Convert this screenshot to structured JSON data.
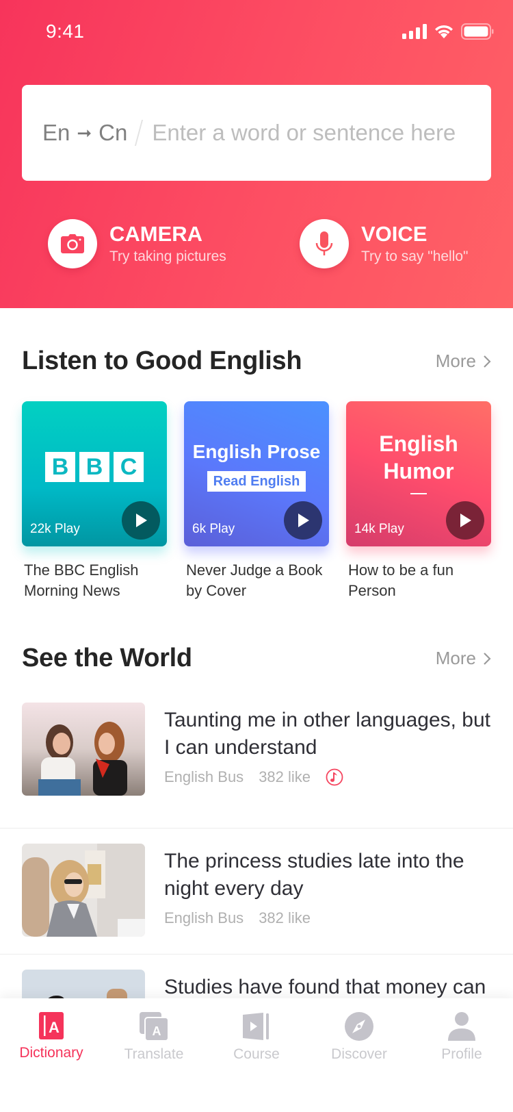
{
  "status_bar": {
    "time": "9:41",
    "icons": [
      "signal-icon",
      "wifi-icon",
      "battery-icon"
    ]
  },
  "search": {
    "source_lang": "En",
    "arrow": "➞",
    "target_lang": "Cn",
    "placeholder": "Enter a word or sentence here",
    "value": ""
  },
  "quick_actions": [
    {
      "icon": "camera-icon",
      "title": "CAMERA",
      "subtitle": "Try taking pictures"
    },
    {
      "icon": "microphone-icon",
      "title": "VOICE",
      "subtitle": "Try to say \"hello\""
    }
  ],
  "listen_section": {
    "title": "Listen to Good English",
    "more_label": "More",
    "cards": [
      {
        "cover": "BBC",
        "logo_letters": [
          "B",
          "B",
          "C"
        ],
        "plays": "22k Play",
        "caption": "The BBC English Morning News"
      },
      {
        "cover": "English Prose",
        "cover_tag": "Read English",
        "plays": "6k Play",
        "caption": "Never Judge a Book by Cover"
      },
      {
        "cover": "English Humor",
        "cover_line1": "English",
        "cover_line2": "Humor",
        "plays": "14k Play",
        "caption": "How to be a fun Person"
      }
    ]
  },
  "world_section": {
    "title": "See the World",
    "more_label": "More",
    "items": [
      {
        "title": "Taunting me in other languages, but I can understand",
        "source": "English Bus",
        "likes": "382 like",
        "has_audio": true
      },
      {
        "title": "The princess studies late into the night every day",
        "source": "English Bus",
        "likes": "382 like",
        "has_audio": false
      },
      {
        "title": "Studies have found that money can make people",
        "source": "",
        "likes": "",
        "has_audio": false
      }
    ]
  },
  "tabbar": {
    "active": "Dictionary",
    "accent_color": "#f5335a",
    "inactive_color": "#c4c3ca",
    "tabs": [
      {
        "label": "Dictionary",
        "icon": "dictionary-icon"
      },
      {
        "label": "Translate",
        "icon": "translate-icon"
      },
      {
        "label": "Course",
        "icon": "course-icon"
      },
      {
        "label": "Discover",
        "icon": "compass-icon"
      },
      {
        "label": "Profile",
        "icon": "person-icon"
      }
    ]
  }
}
